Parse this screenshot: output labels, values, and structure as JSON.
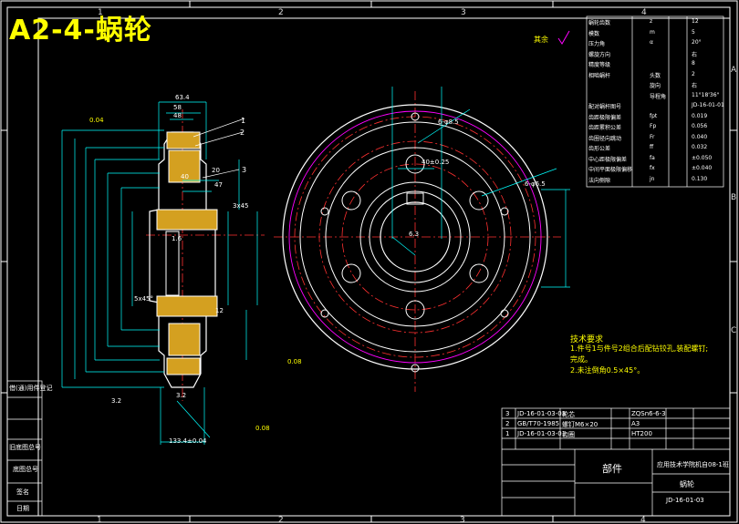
{
  "title": "A2-4-蜗轮",
  "zones_top": [
    "1",
    "2",
    "3",
    "4"
  ],
  "zones_right": [
    "A",
    "B",
    "C"
  ],
  "roughness_other": "其余",
  "dims": {
    "d63_4": "63.4",
    "d58": "58",
    "d48": "48",
    "d10": "10",
    "d40": "40",
    "d20": "20",
    "d47": "47",
    "d8": "8",
    "d3x45": "3x45",
    "d5x45": "5x45°",
    "dia134": "φ134.1m",
    "dia121": "φ121.2",
    "dia104": "φ104",
    "dia85": "φ85",
    "dia80": "φ80",
    "dia60h7": "φ60H7",
    "diaB": "φ62H7/f6",
    "d12": "12",
    "d13_4": "133.4±0.04",
    "d13_5": "18±0.05",
    "bottom32": "3.2",
    "d16": "1.6",
    "d3_2b": "3.2",
    "tol_flat": "0.04",
    "tol_runout": "0.08",
    "tol_A": "A",
    "hole_note": "6-φ8.5",
    "keyway": "40±0.25",
    "d63": "6.3",
    "n_holes": "6-φ6.5",
    "dia_right": "φ14",
    "runout_left": "0.08",
    "runout_bottom": "0.08"
  },
  "labels": [
    "1",
    "2",
    "3"
  ],
  "params": {
    "rows": [
      [
        "蜗轮齿数",
        "z",
        "12"
      ],
      [
        "模数",
        "m",
        "5"
      ],
      [
        "压力角",
        "α",
        "20°"
      ],
      [
        "螺旋方向",
        "",
        "右"
      ],
      [
        "精度等级",
        "",
        "8"
      ],
      [
        "相啮蜗杆",
        "头数",
        "2"
      ],
      [
        "",
        "旋向",
        "右"
      ],
      [
        "",
        "导程角",
        "11°18'36\""
      ],
      [
        "配对蜗杆图号",
        "",
        "JD-16-01-01"
      ],
      [
        "齿距极限偏差",
        "fpt",
        "0.019"
      ],
      [
        "齿距累积公差",
        "Fp",
        "0.056"
      ],
      [
        "齿圈径向跳动",
        "Fr",
        "0.040"
      ],
      [
        "齿形公差",
        "ff",
        "0.032"
      ],
      [
        "中心距极限偏差",
        "fa",
        "±0.050"
      ],
      [
        "中间平面极限偏移",
        "fx",
        "±0.040"
      ],
      [
        "法向侧隙",
        "jn",
        "0.130"
      ]
    ]
  },
  "tech": {
    "heading": "技术要求",
    "lines": [
      "1.件号1与件号2组合后配钻铰孔,装配螺钉;",
      "   完成。",
      "2.未注倒角0.5×45°。"
    ]
  },
  "bom": {
    "rows": [
      [
        "3",
        "JD-16-01-03-03",
        "轮芯",
        "1",
        "ZQSn6-6-3",
        ""
      ],
      [
        "2",
        "GB/T70-1985",
        "螺钉M6×20",
        "6",
        "A3",
        ""
      ],
      [
        "1",
        "JD-16-01-03-01",
        "齿圈",
        "1",
        "HT200",
        ""
      ]
    ],
    "headers": [
      "序",
      "代号",
      "名称",
      "数量",
      "材料",
      "单件",
      "总计",
      "备注"
    ]
  },
  "titleblock": {
    "part": "部件",
    "name": "蜗轮",
    "school": "应用技术学院机自08-1班",
    "drawing_no": "JD-16-01-03",
    "scale": "1:1",
    "sheet": "1/1"
  },
  "left_strip": [
    "借(通)用件登记",
    "旧底图总号",
    "底图总号",
    "签名",
    "日期"
  ]
}
